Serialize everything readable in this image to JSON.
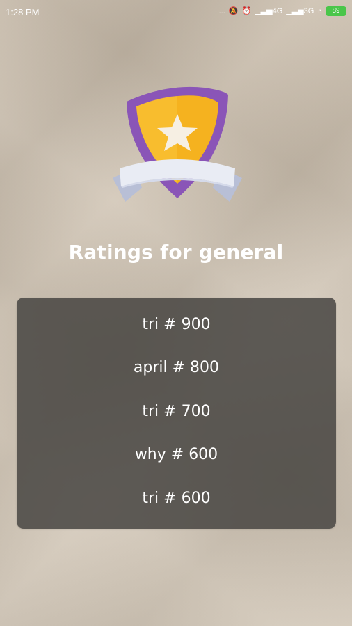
{
  "status_bar": {
    "time": "1:28 PM",
    "dots": "...",
    "net_4g": "4G",
    "net_3g": "3G",
    "battery": "89"
  },
  "header": {
    "title": "Ratings for general"
  },
  "colors": {
    "shield_purple": "#8a55b7",
    "shield_gold": "#f5b21f",
    "star": "#f6efe3",
    "ribbon": "#e9ecf4",
    "ribbon_shadow": "#b8bfd6",
    "panel": "#484642"
  },
  "icons": {
    "badge": "shield-star-ribbon-icon"
  },
  "ratings": [
    {
      "text": "tri # 900"
    },
    {
      "text": "april # 800"
    },
    {
      "text": "tri # 700"
    },
    {
      "text": "why # 600"
    },
    {
      "text": "tri # 600"
    }
  ]
}
